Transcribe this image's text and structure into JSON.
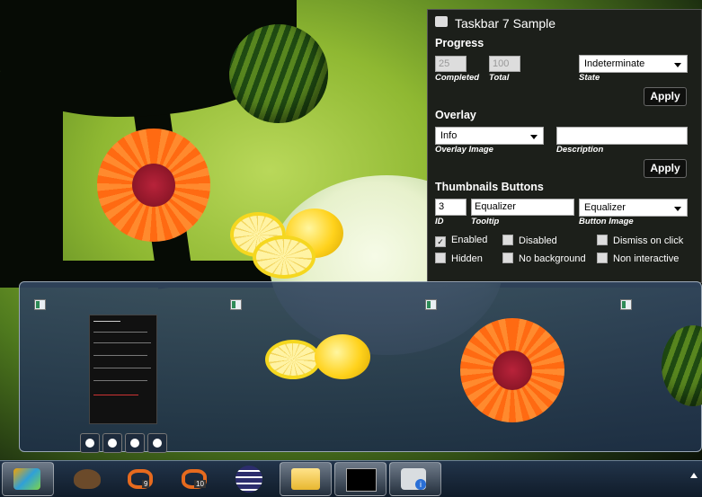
{
  "window": {
    "title": "Taskbar 7 Sample",
    "progress": {
      "heading": "Progress",
      "completed_value": "25",
      "completed_label": "Completed",
      "total_value": "100",
      "total_label": "Total",
      "state_value": "Indeterminate",
      "state_label": "State",
      "apply": "Apply"
    },
    "overlay": {
      "heading": "Overlay",
      "image_value": "Info",
      "image_label": "Overlay Image",
      "description_value": "",
      "description_label": "Description",
      "apply": "Apply"
    },
    "thumbnail_buttons": {
      "heading": "Thumbnails Buttons",
      "id_value": "3",
      "id_label": "ID",
      "tooltip_value": "Equalizer",
      "tooltip_label": "Tooltip",
      "image_value": "Equalizer",
      "image_label": "Button Image",
      "options": [
        {
          "label": "Enabled",
          "checked": true
        },
        {
          "label": "Disabled",
          "checked": false
        },
        {
          "label": "Dismiss on click",
          "checked": false
        },
        {
          "label": "Hidden",
          "checked": false
        },
        {
          "label": "No background",
          "checked": false
        },
        {
          "label": "Non interactive",
          "checked": false
        }
      ]
    }
  },
  "thumbnail_preview": {
    "toolbar_buttons": [
      "play-icon",
      "pause-icon",
      "refresh-icon",
      "equalizer-icon"
    ]
  },
  "taskbar": {
    "items": [
      {
        "name": "start-orb-icon",
        "active": true
      },
      {
        "name": "kiwi-app-icon",
        "active": false
      },
      {
        "name": "visual-studio-9-icon",
        "badge": "9",
        "active": false
      },
      {
        "name": "visual-studio-10-icon",
        "badge": "10",
        "active": false
      },
      {
        "name": "eclipse-icon",
        "active": false
      },
      {
        "name": "explorer-folder-icon",
        "active": true
      },
      {
        "name": "command-prompt-icon",
        "active": true
      },
      {
        "name": "taskbar-7-sample-icon",
        "active": true
      }
    ]
  }
}
